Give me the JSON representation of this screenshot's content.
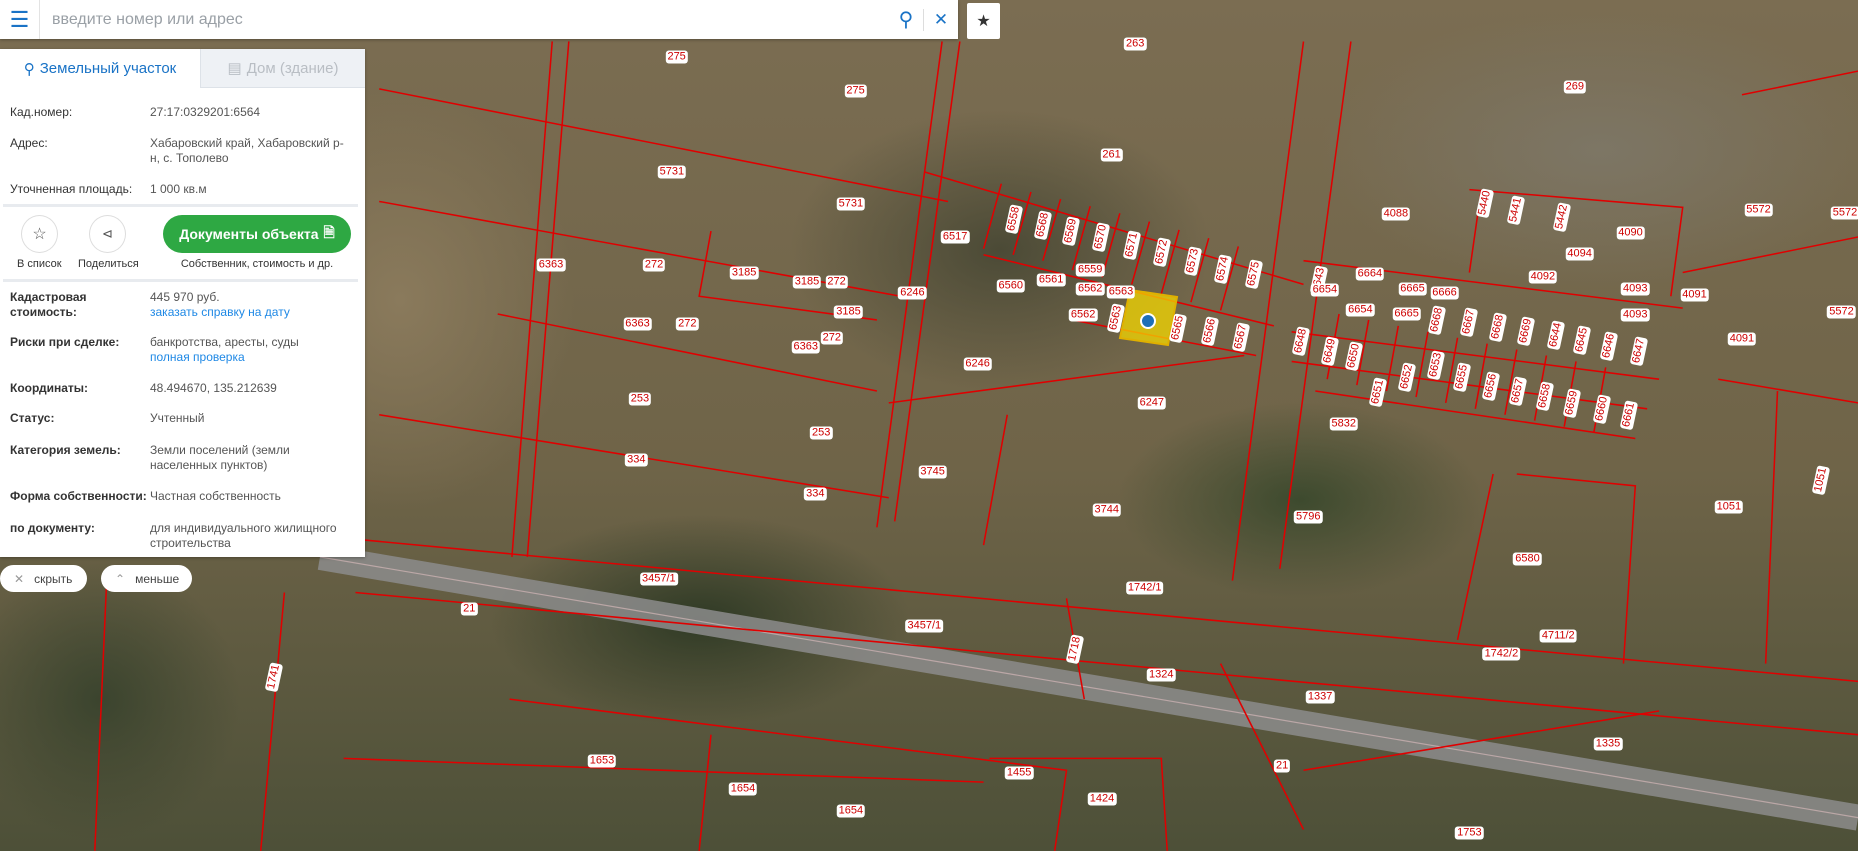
{
  "search": {
    "placeholder": "введите номер или адрес",
    "menu_icon": "hamburger-icon",
    "search_icon": "search-icon",
    "clear_icon": "close-icon",
    "favorite_icon": "star-icon"
  },
  "tabs": [
    {
      "label": "Земельный участок",
      "icon": "map-pin-icon",
      "active": true
    },
    {
      "label": "Дом (здание)",
      "icon": "building-icon",
      "active": false
    }
  ],
  "parcel": {
    "cad_label": "Кад.номер:",
    "cad_value": "27:17:0329201:6564",
    "address_label": "Адрес:",
    "address_value": "Хабаровский край, Хабаровский р-н, с. Тополево",
    "area_label": "Уточненная площадь:",
    "area_value": "1 000 кв.м",
    "cost_label": "Кадастровая стоимость:",
    "cost_value": "445 970 руб.",
    "cost_link": "заказать справку на дату",
    "risk_label": "Риски при сделке:",
    "risk_value": "банкротства, аресты, суды",
    "risk_link": "полная проверка",
    "coords_label": "Координаты:",
    "coords_value": "48.494670, 135.212639",
    "status_label": "Статус:",
    "status_value": "Учтенный",
    "category_label": "Категория земель:",
    "category_value": "Земли поселений (земли населенных пунктов)",
    "ownership_label": "Форма собственности:",
    "ownership_value": "Частная собственность",
    "document_label": "по документу:",
    "document_value": "для индивидуального жилищного строительства"
  },
  "actions": {
    "add_list": "В список",
    "share": "Поделиться",
    "documents": "Документы объекта",
    "documents_sub": "Собственник, стоимость и др."
  },
  "controls": {
    "hide": "скрыть",
    "less": "меньше"
  },
  "colors": {
    "accent": "#1a73c6",
    "button_green": "#2ea843",
    "parcel_border": "#e00000",
    "selected_parcel": "#f5d800"
  },
  "map": {
    "labels": [
      "263",
      "275",
      "275",
      "269",
      "261",
      "5731",
      "5731",
      "6517",
      "6363",
      "272",
      "3185",
      "3185",
      "272",
      "6246",
      "3185",
      "6363",
      "272",
      "272",
      "6363",
      "6246",
      "253",
      "253",
      "334",
      "334",
      "3745",
      "3744",
      "6247",
      "5832",
      "5796",
      "6580",
      "1051",
      "1051",
      "4088",
      "4090",
      "4094",
      "4092",
      "4093",
      "4093",
      "4091",
      "4091",
      "5572",
      "5572",
      "5572",
      "3457/1",
      "3457/1",
      "1742/1",
      "1742/2",
      "4711/2",
      "21",
      "21",
      "1718",
      "1741",
      "1324",
      "1337",
      "1335",
      "1653",
      "1654",
      "1654",
      "1455",
      "1424",
      "1753",
      "6558",
      "6568",
      "6569",
      "6570",
      "6571",
      "6572",
      "6573",
      "6574",
      "6575",
      "6560",
      "6561",
      "6559",
      "6562",
      "6563",
      "6562",
      "6563",
      "6565",
      "6566",
      "6567",
      "6643",
      "6664",
      "6665",
      "6666",
      "6654",
      "6654",
      "6665",
      "6668",
      "6667",
      "6668",
      "6669",
      "6644",
      "6645",
      "6646",
      "6647",
      "6648",
      "6649",
      "6650",
      "6651",
      "6652",
      "6653",
      "6655",
      "6656",
      "6657",
      "6658",
      "6659",
      "6660",
      "6661",
      "5440",
      "5441",
      "5442"
    ]
  }
}
